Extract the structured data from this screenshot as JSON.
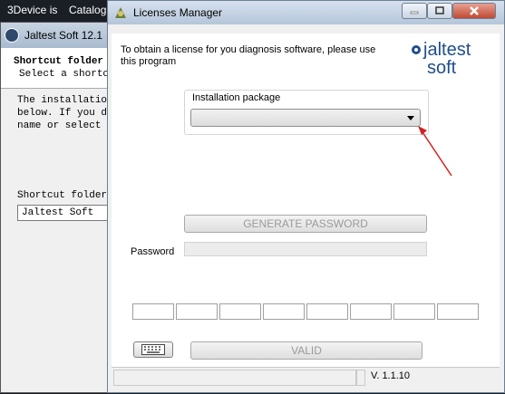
{
  "desktop": {
    "label_1": "3Device is",
    "label_2": "Catalog"
  },
  "background_window": {
    "title": "Jaltest Soft 12.1",
    "heading": "Shortcut folder",
    "subheading": "Select a shortcu",
    "paragraph_lines": [
      "The installation",
      "below. If you do",
      "name or select a"
    ],
    "folder_label": "Shortcut folder:",
    "folder_value": "Jaltest Soft"
  },
  "main_window": {
    "title": "Licenses Manager",
    "info_text": "To obtain a license for you diagnosis software, please use this program",
    "logo": {
      "brand": "jaltest",
      "sub": "soft"
    },
    "installation_group_label": "Installation package",
    "installation_selected": "",
    "generate_label": "GENERATE PASSWORD",
    "password_label": "Password",
    "password_value": "",
    "valid_label": "VALID",
    "version": "V. 1.1.10",
    "code_fields": [
      "",
      "",
      "",
      "",
      "",
      "",
      "",
      ""
    ]
  },
  "icons": {
    "minimize": "minimize-icon",
    "maximize": "maximize-icon",
    "close": "close-icon",
    "keyboard": "keyboard-icon",
    "dropdown": "chevron-down-icon"
  },
  "colors": {
    "arrow": "#d22020",
    "logo_blue": "#1f4e8c"
  }
}
